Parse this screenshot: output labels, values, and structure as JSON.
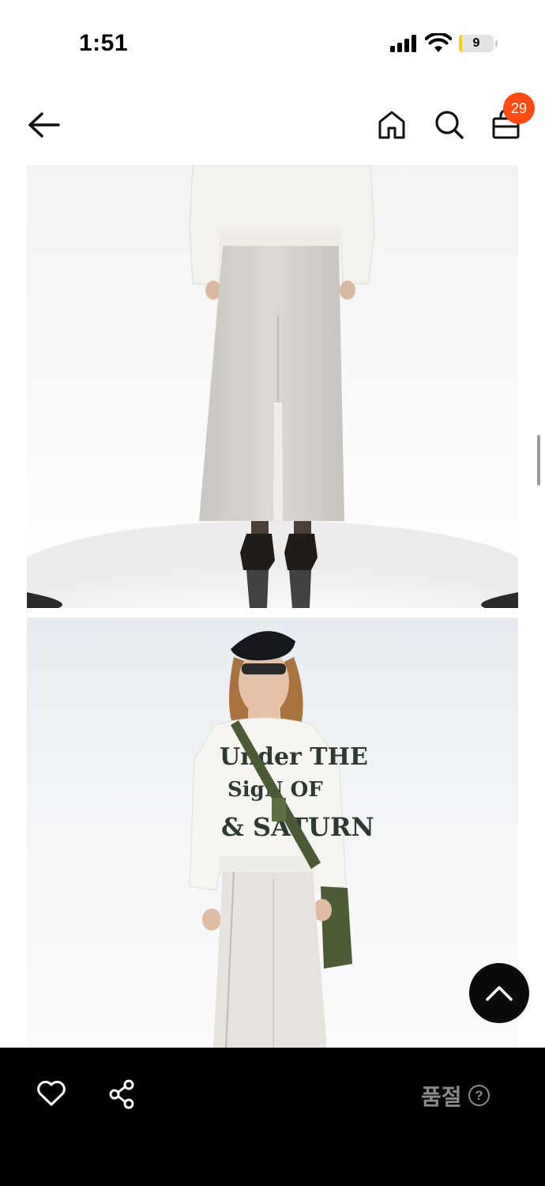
{
  "status_bar": {
    "time": "1:51",
    "battery_level": "9",
    "battery_fraction": 0.09
  },
  "nav": {
    "back_icon": "arrow-left-icon",
    "home_icon": "home-icon",
    "search_icon": "search-icon",
    "cart_icon": "shopping-bag-icon",
    "cart_count": "29"
  },
  "product_images": [
    {
      "description_icon": "product-photo-skirt-back"
    },
    {
      "description_icon": "product-photo-model-front",
      "print_lines": [
        "Under THE",
        "SigN OF",
        "& SATURN"
      ]
    }
  ],
  "bottom_bar": {
    "favorite_icon": "heart-icon",
    "share_icon": "share-icon",
    "status_label": "품절",
    "help_icon": "question-circle-icon"
  },
  "colors": {
    "badge": "#ff4b12",
    "bottom_bar": "#000000",
    "disabled_text": "#8a8a8a"
  }
}
